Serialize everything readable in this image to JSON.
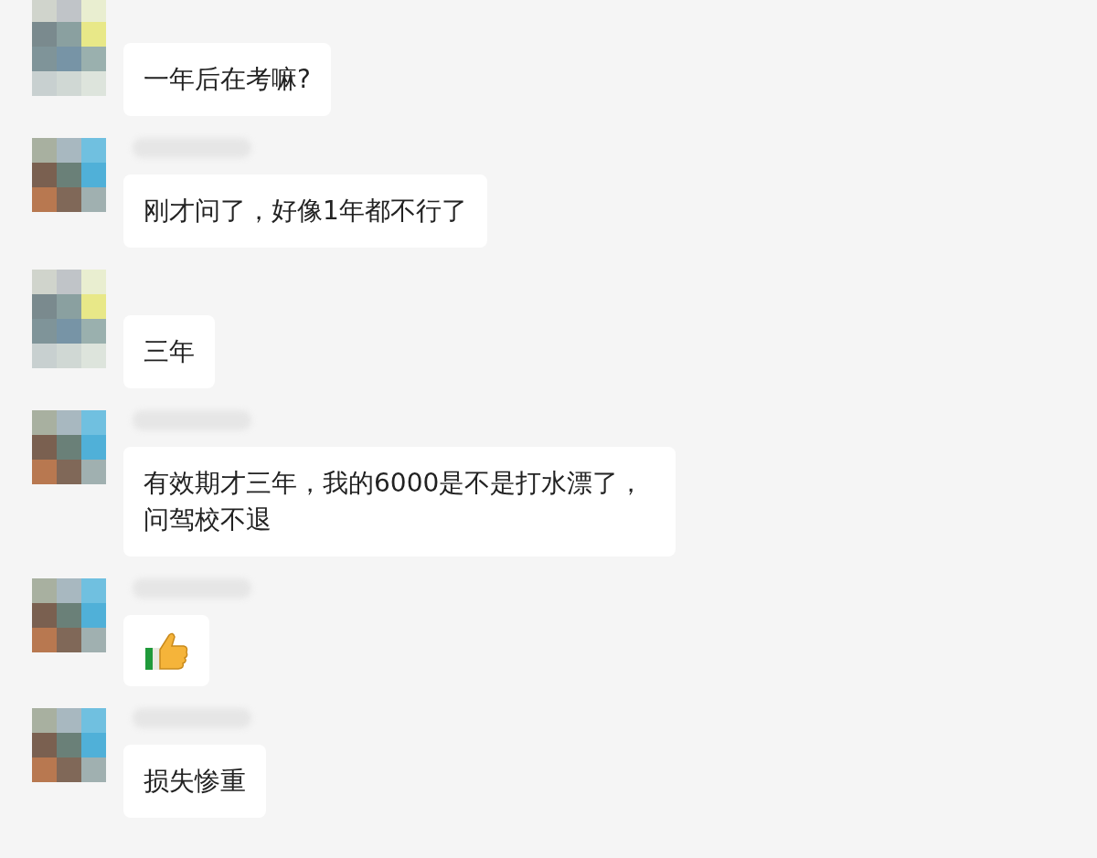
{
  "messages": [
    {
      "show_name": false,
      "kind": "text",
      "text": "一年后在考嘛?"
    },
    {
      "show_name": true,
      "kind": "text",
      "text": "刚才问了，好像1年都不行了"
    },
    {
      "show_name": false,
      "kind": "text",
      "text": "三年"
    },
    {
      "show_name": true,
      "kind": "text",
      "text": "有效期才三年，我的6000是不是打水漂了，问驾校不退"
    },
    {
      "show_name": true,
      "kind": "emoji"
    },
    {
      "show_name": true,
      "kind": "text",
      "text": "损失惨重"
    }
  ]
}
